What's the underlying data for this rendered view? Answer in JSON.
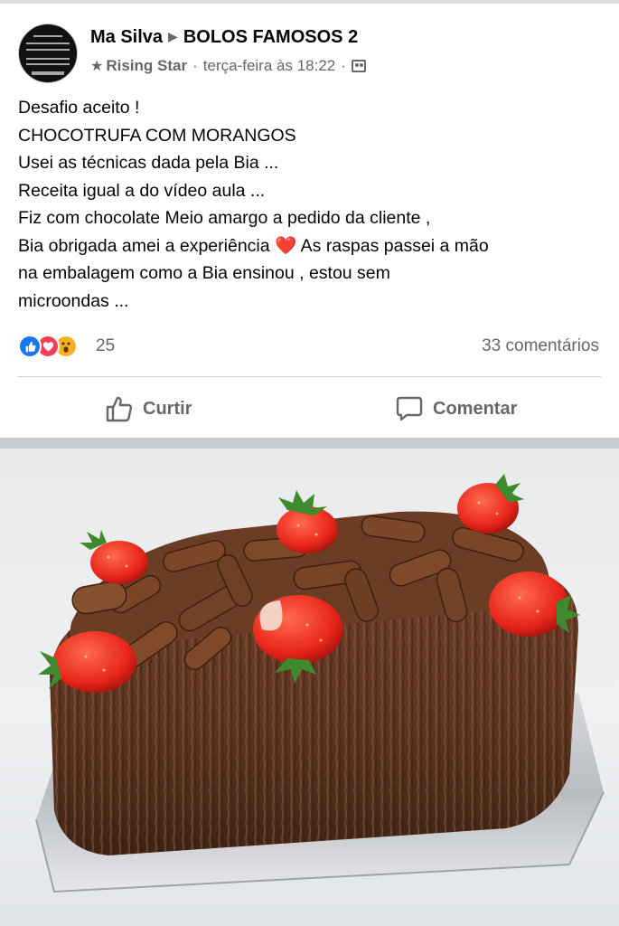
{
  "post": {
    "author": "Ma Silva",
    "group": "BOLOS FAMOSOS 2",
    "badge": "Rising Star",
    "timestamp": "terça-feira às 18:22",
    "text_lines": [
      "Desafio aceito !",
      "CHOCOTRUFA COM MORANGOS",
      "Usei as técnicas dada pela Bia ...",
      "Receita igual a do vídeo aula ...",
      "Fiz com chocolate Meio amargo a pedido da cliente ,",
      "Bia obrigada amei a experiência",
      "As raspas passei a mão",
      "na embalagem como a Bia ensinou , estou sem",
      "microondas ..."
    ],
    "heart_emoji": "❤️"
  },
  "reactions": {
    "count": "25",
    "types": [
      "like",
      "love",
      "wow"
    ],
    "comments": "33 comentários"
  },
  "actions": {
    "like_label": "Curtir",
    "comment_label": "Comentar"
  },
  "colors": {
    "secondary_text": "#65676b",
    "like_blue": "#1877f2",
    "love_red": "#f33e58",
    "wow_yellow": "#f7b125"
  }
}
